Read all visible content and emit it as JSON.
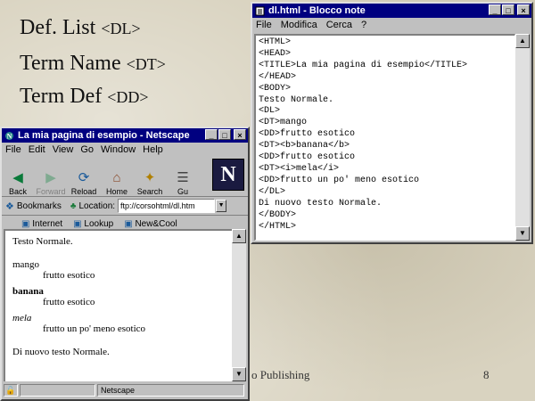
{
  "slide": {
    "lines": [
      {
        "label": "Def. List",
        "tag": "<DL>"
      },
      {
        "label": "Term Name",
        "tag": "<DT>"
      },
      {
        "label": "Term Def",
        "tag": "<DD>"
      }
    ],
    "footer_left": "o Publishing",
    "page_number": "8"
  },
  "notepad": {
    "title": "dl.html - Blocco note",
    "menu": [
      "File",
      "Modifica",
      "Cerca",
      "?"
    ],
    "lines": [
      "<HTML>",
      "<HEAD>",
      "<TITLE>La mia pagina di esempio</TITLE>",
      "</HEAD>",
      "<BODY>",
      "Testo Normale.",
      "<DL>",
      "<DT>mango",
      "<DD>frutto esotico",
      "<DT><b>banana</b>",
      "<DD>frutto esotico",
      "<DT><i>mela</i>",
      "<DD>frutto un po' meno esotico",
      "</DL>",
      "Di nuovo testo Normale.",
      "</BODY>",
      "</HTML>"
    ]
  },
  "netscape": {
    "title": "La mia pagina di esempio - Netscape",
    "menu": [
      "File",
      "Edit",
      "View",
      "Go",
      "Window",
      "Help"
    ],
    "toolbar": [
      "Back",
      "Forward",
      "Reload",
      "Home",
      "Search",
      "Gu"
    ],
    "bookmarks_label": "Bookmarks",
    "location_label": "Location:",
    "location_value": "ftp://corsohtml/dl.htm",
    "directory_buttons": [
      "Internet",
      "Lookup",
      "New&Cool"
    ],
    "content": {
      "intro": "Testo Normale.",
      "list": [
        {
          "term": "mango",
          "def": "frutto esotico",
          "style": "normal"
        },
        {
          "term": "banana",
          "def": "frutto esotico",
          "style": "bold"
        },
        {
          "term": "mela",
          "def": "frutto un po' meno esotico",
          "style": "italic"
        }
      ],
      "outro": "Di nuovo testo Normale."
    },
    "status": "Netscape"
  }
}
